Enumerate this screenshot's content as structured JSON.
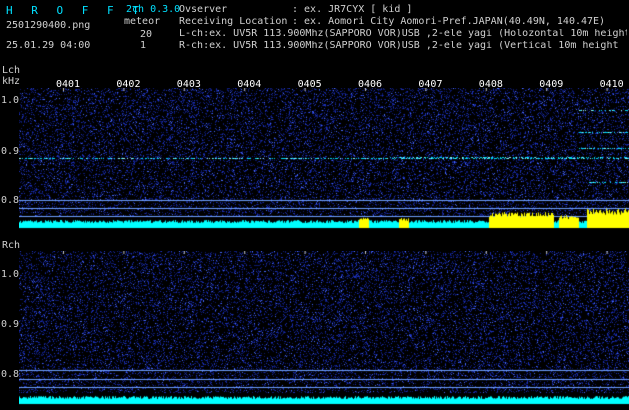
{
  "header": {
    "logo": "H R O F F T",
    "filename": "2501290400.png",
    "datetime": "25.01.29 04:00",
    "mode": "2ch 0.3.0",
    "meteor_label": "meteor",
    "meteor_count_l": "20",
    "meteor_count_r": "1",
    "observer_label": "Ovserver",
    "observer_value": ": ex. JR7CYX [ kid ]",
    "location_label": "Receiving Location",
    "location_value": ": ex. Aomori City Aomori-Pref.JAPAN(40.49N, 140.47E)",
    "lch_info": "L-ch:ex. UV5R 113.900Mhz(SAPPORO VOR)USB ,2-ele yagi (Holozontal 10m height",
    "rch_info": "R-ch:ex. UV5R 113.900Mhz(SAPPORO VOR)USB ,2-ele yagi (Vertical 10m height"
  },
  "time_ticks": [
    "0401",
    "0402",
    "0403",
    "0404",
    "0405",
    "0406",
    "0407",
    "0408",
    "0409",
    "0410"
  ],
  "lch": {
    "label": "Lch",
    "unit": "kHz",
    "freq_ticks": [
      "1.0",
      "0.9",
      "0.8"
    ]
  },
  "rch": {
    "label": "Rch",
    "freq_ticks": [
      "1.0",
      "0.9",
      "0.8"
    ]
  },
  "colors": {
    "background": "#000000",
    "noise": "#1a2aa0",
    "trace": "#00e0ff",
    "level": "#00ffff",
    "burst": "#ffff00",
    "gridline": "#6fa0ff"
  }
}
